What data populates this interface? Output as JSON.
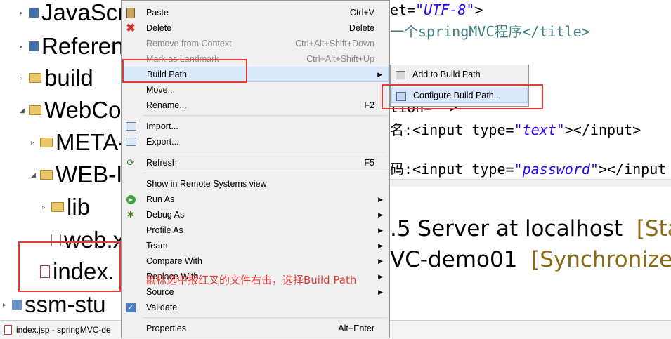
{
  "tree": {
    "items": [
      {
        "label": "JavaScr",
        "icon": "library-icon"
      },
      {
        "label": "Referen",
        "icon": "library-icon"
      },
      {
        "label": "build",
        "icon": "folder-icon"
      },
      {
        "label": "WebCo",
        "icon": "folder-icon"
      },
      {
        "label": "META-",
        "icon": "folder-icon"
      },
      {
        "label": "WEB-I",
        "icon": "folder-icon"
      },
      {
        "label": "lib",
        "icon": "folder-icon"
      },
      {
        "label": "web.x",
        "icon": "xml-file-icon"
      },
      {
        "label": "index.",
        "icon": "jsp-file-icon"
      },
      {
        "label": "ssm-stu",
        "icon": "project-icon"
      }
    ]
  },
  "editor": {
    "lines": [
      {
        "pre": "et=",
        "str": "\"UTF-8\"",
        "post": ">"
      },
      {
        "pre": "一个springMVC程序</title>",
        "str": "",
        "post": ""
      },
      {
        "pre": "tion=\"",
        "str": "",
        "post": "\">"
      },
      {
        "pre": "名:<input type=",
        "str": "\"text\"",
        "post": "></input>"
      },
      {
        "pre": "码:<input type=",
        "str": "\"password\"",
        "post": "></input"
      }
    ]
  },
  "servers": {
    "line1_main": ".5 Server at localhost",
    "line1_status": "[Sta",
    "line2_main": "VC-demo01",
    "line2_status": "[Synchronized"
  },
  "context_menu": {
    "items": [
      {
        "label": "Paste",
        "shortcut": "Ctrl+V",
        "icon": "paste-icon"
      },
      {
        "label": "Delete",
        "shortcut": "Delete",
        "icon": "delete-icon"
      },
      {
        "label": "Remove from Context",
        "shortcut": "Ctrl+Alt+Shift+Down",
        "disabled": true
      },
      {
        "label": "Mark as Landmark",
        "shortcut": "Ctrl+Alt+Shift+Up",
        "disabled": true
      },
      {
        "label": "Build Path",
        "submenu": true
      },
      {
        "label": "Move..."
      },
      {
        "label": "Rename...",
        "shortcut": "F2"
      },
      {
        "label": "Import...",
        "icon": "import-icon"
      },
      {
        "label": "Export...",
        "icon": "export-icon"
      },
      {
        "label": "Refresh",
        "shortcut": "F5",
        "icon": "refresh-icon"
      },
      {
        "label": "Show in Remote Systems view"
      },
      {
        "label": "Run As",
        "submenu": true,
        "icon": "run-icon"
      },
      {
        "label": "Debug As",
        "submenu": true,
        "icon": "debug-icon"
      },
      {
        "label": "Profile As",
        "submenu": true
      },
      {
        "label": "Team",
        "submenu": true
      },
      {
        "label": "Compare With",
        "submenu": true
      },
      {
        "label": "Replace With",
        "submenu": true
      },
      {
        "label": "Source",
        "submenu": true
      },
      {
        "label": "Validate",
        "icon": "validate-check-icon"
      },
      {
        "label": "Properties",
        "shortcut": "Alt+Enter"
      }
    ]
  },
  "submenu": {
    "items": [
      {
        "label": "Add to Build Path",
        "icon": "jar-icon"
      },
      {
        "label": "Configure Build Path...",
        "icon": "build-path-icon"
      }
    ]
  },
  "annotation": "鼠标选中报红叉的文件右击，选择Build Path",
  "statusbar": {
    "text": "index.jsp - springMVC-de"
  },
  "colors": {
    "annotation_red": "#e53935",
    "menu_bg": "#f0f0f0",
    "highlight": "#d9e8fb"
  }
}
